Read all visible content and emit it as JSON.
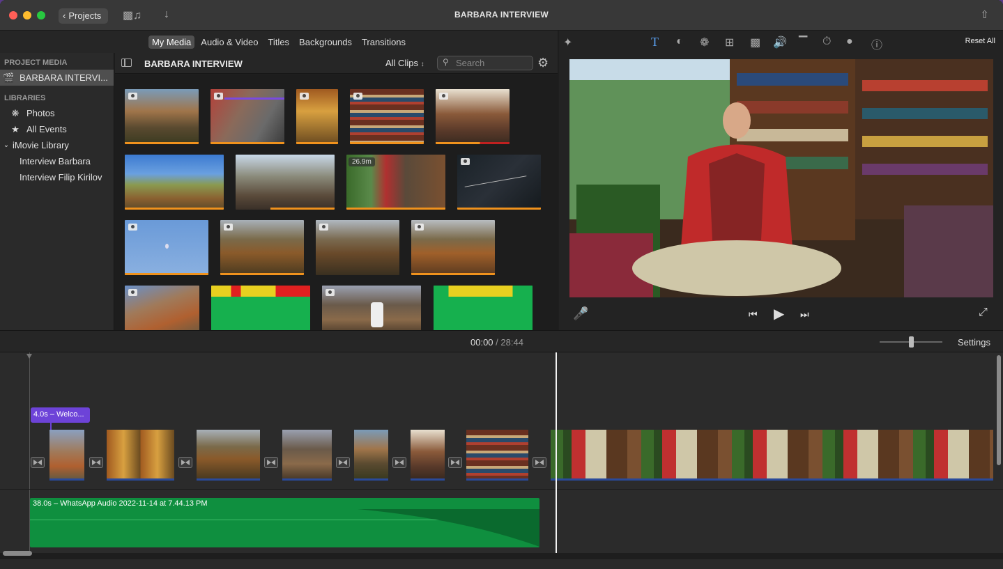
{
  "window": {
    "title": "BARBARA INTERVIEW",
    "projects_label": "Projects"
  },
  "media_tabs": [
    "My Media",
    "Audio & Video",
    "Titles",
    "Backgrounds",
    "Transitions"
  ],
  "sidebar": {
    "project_media_header": "PROJECT MEDIA",
    "project_item": "BARBARA INTERVI...",
    "libraries_header": "LIBRARIES",
    "items": [
      {
        "label": "Photos",
        "icon": "photos-icon"
      },
      {
        "label": "All Events",
        "icon": "star-icon"
      },
      {
        "label": "iMovie Library",
        "icon": "chevron-down-icon"
      },
      {
        "label": "Interview Barbara",
        "icon": ""
      },
      {
        "label": "Interview Filip Kirilov",
        "icon": ""
      }
    ]
  },
  "browser": {
    "title": "BARBARA INTERVIEW",
    "filter": "All Clips",
    "search_placeholder": "Search",
    "clip_duration": "26.9m"
  },
  "viewer": {
    "reset_label": "Reset All"
  },
  "timebar": {
    "current": "00:00",
    "separator": "/",
    "total": "28:44",
    "settings_label": "Settings",
    "zoom_level": 0.5
  },
  "timeline": {
    "title_clip": "4.0s – Welco...",
    "audio_clip": "38.0s – WhatsApp Audio 2022-11-14 at 7.44.13 PM"
  },
  "colors": {
    "accent": "#6d43d8",
    "audio": "#0f8f3f",
    "clip_bar": "#f0921d"
  }
}
